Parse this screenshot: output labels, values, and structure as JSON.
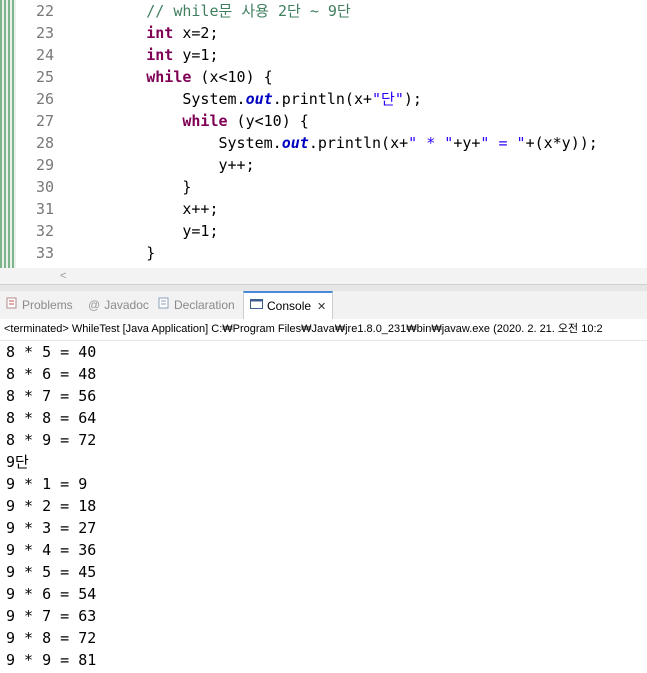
{
  "editor": {
    "lines": [
      {
        "num": "22",
        "segments": [
          {
            "t": "        ",
            "c": ""
          },
          {
            "t": "// while문 사용 2단 ~ 9단",
            "c": "cm"
          }
        ]
      },
      {
        "num": "23",
        "segments": [
          {
            "t": "        ",
            "c": ""
          },
          {
            "t": "int",
            "c": "kw"
          },
          {
            "t": " x=2;",
            "c": ""
          }
        ]
      },
      {
        "num": "24",
        "segments": [
          {
            "t": "        ",
            "c": ""
          },
          {
            "t": "int",
            "c": "kw"
          },
          {
            "t": " y=1;",
            "c": ""
          }
        ]
      },
      {
        "num": "25",
        "segments": [
          {
            "t": "        ",
            "c": ""
          },
          {
            "t": "while",
            "c": "kw"
          },
          {
            "t": " (x<10) {",
            "c": ""
          }
        ]
      },
      {
        "num": "26",
        "segments": [
          {
            "t": "            System.",
            "c": ""
          },
          {
            "t": "out",
            "c": "fld"
          },
          {
            "t": ".println(x+",
            "c": ""
          },
          {
            "t": "\"단\"",
            "c": "st"
          },
          {
            "t": ");",
            "c": ""
          }
        ]
      },
      {
        "num": "27",
        "segments": [
          {
            "t": "            ",
            "c": ""
          },
          {
            "t": "while",
            "c": "kw"
          },
          {
            "t": " (y<10) {",
            "c": ""
          }
        ]
      },
      {
        "num": "28",
        "segments": [
          {
            "t": "                System.",
            "c": ""
          },
          {
            "t": "out",
            "c": "fld"
          },
          {
            "t": ".println(x+",
            "c": ""
          },
          {
            "t": "\" * \"",
            "c": "st"
          },
          {
            "t": "+y+",
            "c": ""
          },
          {
            "t": "\" = \"",
            "c": "st"
          },
          {
            "t": "+(x*y));",
            "c": ""
          }
        ]
      },
      {
        "num": "29",
        "segments": [
          {
            "t": "                y++;",
            "c": ""
          }
        ]
      },
      {
        "num": "30",
        "segments": [
          {
            "t": "            }",
            "c": ""
          }
        ]
      },
      {
        "num": "31",
        "segments": [
          {
            "t": "            x++;",
            "c": ""
          }
        ]
      },
      {
        "num": "32",
        "segments": [
          {
            "t": "            y=1;",
            "c": ""
          }
        ]
      },
      {
        "num": "33",
        "segments": [
          {
            "t": "        }",
            "c": ""
          }
        ]
      }
    ],
    "scroll_arrow": "<"
  },
  "tabs": {
    "problems": "Problems",
    "javadoc": "Javadoc",
    "declaration": "Declaration",
    "console": "Console",
    "close_glyph": "✕"
  },
  "console": {
    "header": "<terminated> WhileTest [Java Application] C:₩Program Files₩Java₩jre1.8.0_231₩bin₩javaw.exe (2020. 2. 21. 오전 10:2",
    "output": [
      "8 * 5 = 40",
      "8 * 6 = 48",
      "8 * 7 = 56",
      "8 * 8 = 64",
      "8 * 9 = 72",
      "9단",
      "9 * 1 = 9",
      "9 * 2 = 18",
      "9 * 3 = 27",
      "9 * 4 = 36",
      "9 * 5 = 45",
      "9 * 6 = 54",
      "9 * 7 = 63",
      "9 * 8 = 72",
      "9 * 9 = 81"
    ]
  },
  "icons": {
    "problems": "problems-icon",
    "javadoc": "javadoc-icon",
    "declaration": "declaration-icon",
    "console": "console-icon"
  }
}
